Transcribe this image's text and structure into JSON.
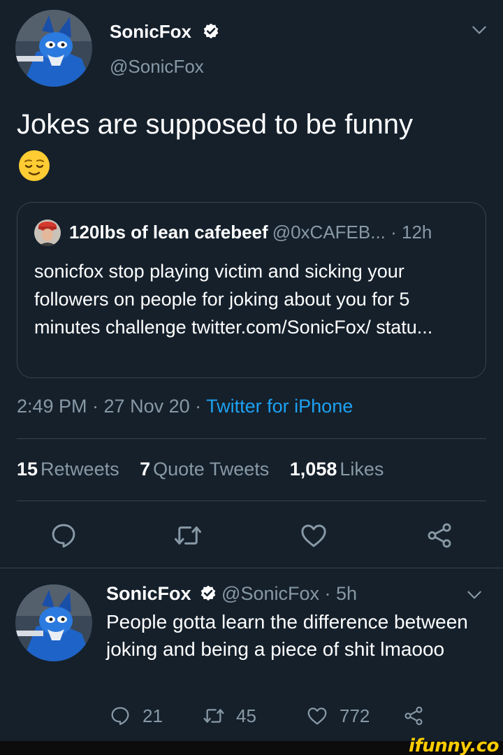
{
  "main_tweet": {
    "author_name": "SonicFox",
    "author_handle": "@SonicFox",
    "text": "Jokes are supposed to be funny",
    "emoji": "relieved-face",
    "quoted_tweet": {
      "author_name": "120lbs of lean cafebeef",
      "meta": "@0xCAFEB... · 12h",
      "text": "sonicfox stop playing victim and sicking your followers on people for joking about you for 5 minutes challenge twitter.com/SonicFox/ statu..."
    },
    "time": "2:49 PM · 27 Nov 20 · ",
    "source": "Twitter for iPhone",
    "stats": [
      {
        "count": "15",
        "label": "Retweets"
      },
      {
        "count": "7",
        "label": "Quote Tweets"
      },
      {
        "count": "1,058",
        "label": "Likes"
      }
    ]
  },
  "reply_tweet": {
    "author_name": "SonicFox",
    "meta": "@SonicFox · 5h",
    "text": "People gotta learn the difference between joking and being a piece of shit lmaooo",
    "replies": "21",
    "retweets": "45",
    "likes": "772"
  },
  "watermark": "ifunny.co",
  "colors": {
    "background": "#15202b",
    "secondary_text": "#8899a6",
    "link": "#1da1f2",
    "divider": "#38444d",
    "watermark": "#ffcc00"
  }
}
